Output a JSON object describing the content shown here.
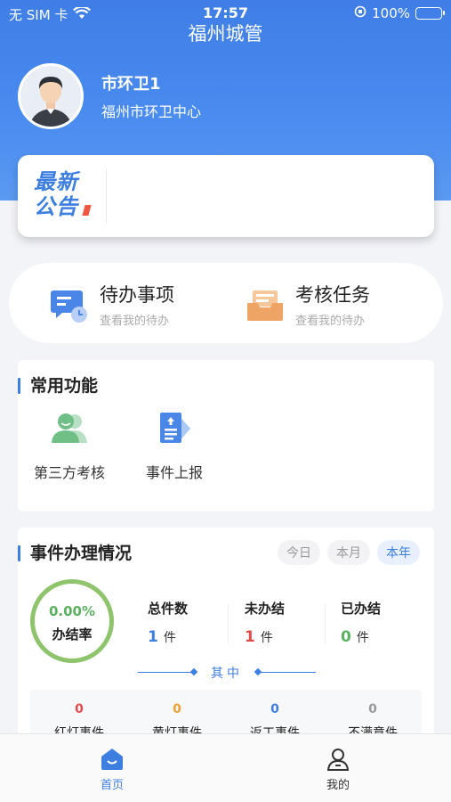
{
  "status_bar": {
    "carrier": "无 SIM 卡",
    "time": "17:57",
    "battery": "100%"
  },
  "header": {
    "title": "福州城管"
  },
  "profile": {
    "name": "市环卫1",
    "org": "福州市环卫中心"
  },
  "notice": {
    "logo_line1": "最新",
    "logo_line2": "公告"
  },
  "tasks": [
    {
      "title": "待办事项",
      "subtitle": "查看我的待办",
      "icon": "message-clock-icon"
    },
    {
      "title": "考核任务",
      "subtitle": "查看我的待办",
      "icon": "inbox-tray-icon"
    }
  ],
  "common_functions": {
    "title": "常用功能",
    "items": [
      {
        "label": "第三方考核",
        "icon": "users-icon"
      },
      {
        "label": "事件上报",
        "icon": "report-upload-icon"
      }
    ]
  },
  "events": {
    "title": "事件办理情况",
    "periods": [
      "今日",
      "本月",
      "本年"
    ],
    "active_period": "本年",
    "rate_value": "0.00%",
    "rate_label": "办结率",
    "stats": [
      {
        "label": "总件数",
        "value": "1",
        "unit": "件",
        "color": "#3d7fe0"
      },
      {
        "label": "未办结",
        "value": "1",
        "unit": "件",
        "color": "#e24b4b"
      },
      {
        "label": "已办结",
        "value": "0",
        "unit": "件",
        "color": "#5bb15f"
      }
    ],
    "divider_text": "其中",
    "sub_stats": [
      {
        "label": "红灯事件",
        "value": "0",
        "color": "#e24b4b"
      },
      {
        "label": "黄灯事件",
        "value": "0",
        "color": "#f0a030"
      },
      {
        "label": "返工事件",
        "value": "0",
        "color": "#3d7fe0"
      },
      {
        "label": "不满意件",
        "value": "0",
        "color": "#999999"
      }
    ]
  },
  "tabbar": {
    "items": [
      {
        "label": "首页",
        "icon": "home-icon",
        "active": true
      },
      {
        "label": "我的",
        "icon": "person-icon",
        "active": false
      }
    ],
    "active_color": "#3d7fe0"
  }
}
